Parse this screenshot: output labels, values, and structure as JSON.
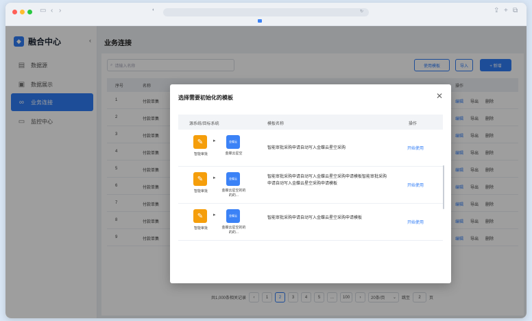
{
  "sidebar": {
    "brand_title": "融合中心",
    "collapse_glyph": "‹",
    "items": [
      {
        "label": "数据源",
        "icon": "database-icon",
        "active": false
      },
      {
        "label": "数据展示",
        "icon": "display-icon",
        "active": false
      },
      {
        "label": "业务连接",
        "icon": "link-icon",
        "active": true
      },
      {
        "label": "监控中心",
        "icon": "monitor-icon",
        "active": false
      }
    ]
  },
  "page": {
    "title": "业务连接",
    "search_placeholder": "请输入名称",
    "buttons": {
      "template": "使用模板",
      "import": "导入",
      "add": "+ 新增"
    },
    "columns": {
      "index": "序号",
      "name": "名称",
      "actions": "操作"
    },
    "rows": [
      {
        "index": "1",
        "name": "付款单集"
      },
      {
        "index": "2",
        "name": "付款单集"
      },
      {
        "index": "3",
        "name": "付款单集"
      },
      {
        "index": "4",
        "name": "付款单集"
      },
      {
        "index": "5",
        "name": "付款单集"
      },
      {
        "index": "6",
        "name": "付款单集"
      },
      {
        "index": "7",
        "name": "付款单集"
      },
      {
        "index": "8",
        "name": "付款单集"
      },
      {
        "index": "9",
        "name": "付款单集"
      }
    ],
    "row_actions": {
      "edit": "编辑",
      "export": "导出",
      "delete": "删除"
    }
  },
  "pagination": {
    "total": "共1,000条相关记录",
    "prev": "‹",
    "next": "›",
    "pages": [
      "1",
      "2",
      "3",
      "4",
      "5",
      "...",
      "100"
    ],
    "current": "2",
    "page_size": "20条/页",
    "goto_label": "跳至",
    "goto_value": "2",
    "goto_suffix": "页"
  },
  "modal": {
    "title": "选择需要初始化的模板",
    "close_glyph": "✕",
    "columns": {
      "system": "源系统/目标系统",
      "template": "模板名称",
      "action": "操作"
    },
    "rows": [
      {
        "source": "智能审批",
        "target": "金蝶云星空",
        "template": "智能审批采购申请自动写入金蝶云星空采购",
        "action": "开始使用"
      },
      {
        "source": "智能审批",
        "target": "金蝶云星空的的的的...",
        "template": "智能审批采购申请自动写入金蝶云星空采购申请模板智能审批采购申请自动写入金蝶云星空采购申请模板",
        "action": "开始使用"
      },
      {
        "source": "智能审批",
        "target": "金蝶云星空的的的的...",
        "template": "智能审批采购申请自动写入金蝶云星空采购申请模板",
        "action": "开始使用"
      }
    ],
    "target_badge": "金蝶云"
  },
  "colors": {
    "primary": "#2f7cf6",
    "source_icon": "#f59e0b",
    "target_icon": "#3b82f6"
  }
}
